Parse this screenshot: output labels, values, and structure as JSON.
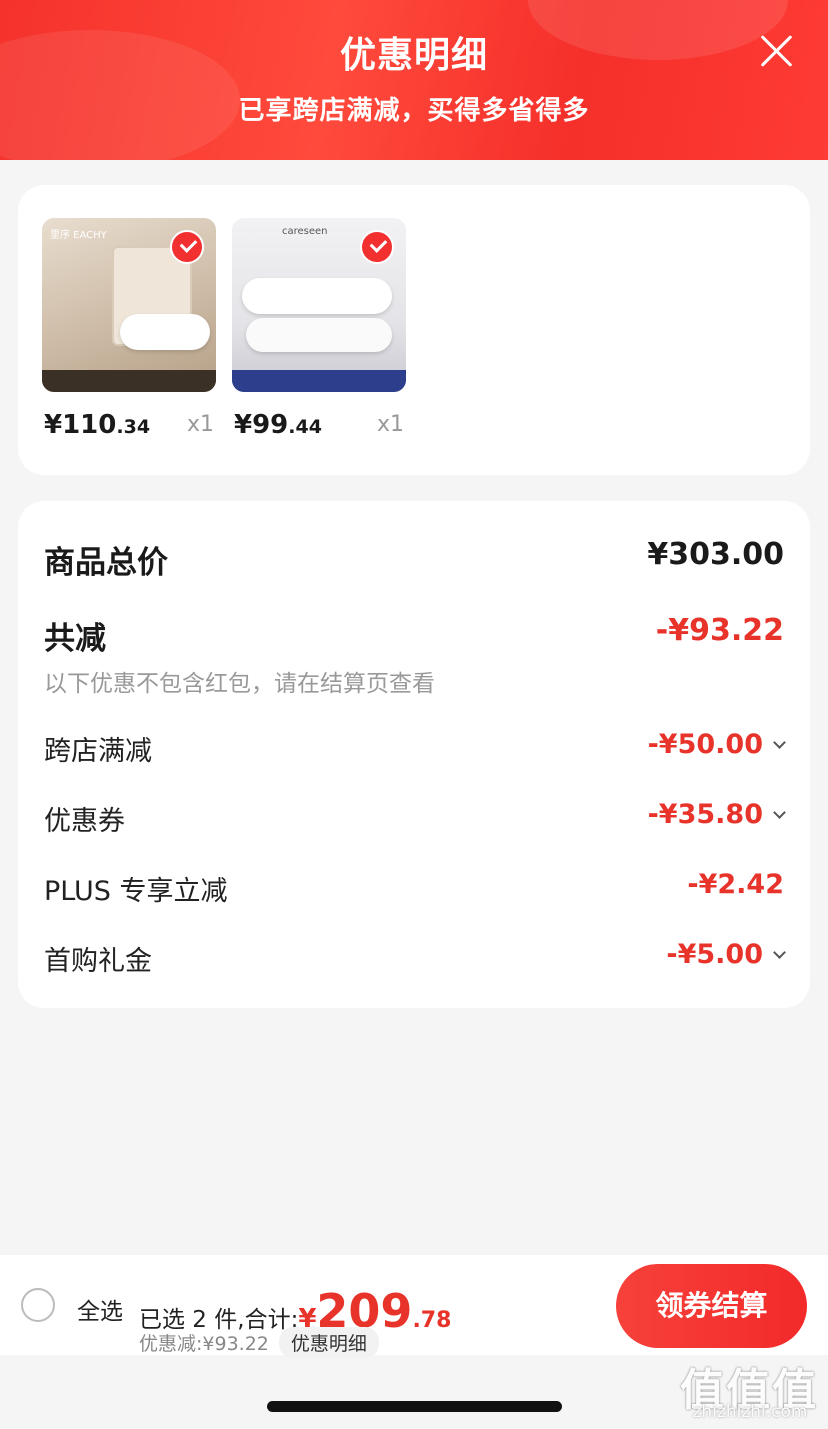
{
  "header": {
    "title": "优惠明细",
    "subtitle": "已享跨店满减，买得多省得多"
  },
  "products": [
    {
      "brand_text": "里序 EACHY",
      "price_int": "¥110",
      "price_dec": ".34",
      "qty": "x1",
      "selected": true
    },
    {
      "brand_text": "careseen",
      "price_int": "¥99",
      "price_dec": ".44",
      "qty": "x1",
      "selected": true
    }
  ],
  "summary": {
    "total_label": "商品总价",
    "total_value": "¥303.00",
    "reduced_label": "共减",
    "reduced_value": "-¥93.22",
    "note": "以下优惠不包含红包，请在结算页查看",
    "items": [
      {
        "label": "跨店满减",
        "value": "-¥50.00",
        "expandable": true
      },
      {
        "label": "优惠券",
        "value": "-¥35.80",
        "expandable": true
      },
      {
        "label": "PLUS 专享立减",
        "value": "-¥2.42",
        "expandable": false
      },
      {
        "label": "首购礼金",
        "value": "-¥5.00",
        "expandable": true
      }
    ]
  },
  "bottom": {
    "select_all": "全选",
    "selected_text": "已选 2 件,合计:",
    "total_yen": "¥",
    "total_int": "209",
    "total_dec": ".78",
    "discount_text": "优惠减:¥93.22",
    "detail_link": "优惠明细",
    "checkout": "领券结算"
  },
  "watermark": {
    "glyphs": "值值值",
    "url": "zhizhizhi.com"
  },
  "colors": {
    "accent_red": "#e8332b",
    "header_red": "#f5322c",
    "background": "#f5f5f5"
  }
}
